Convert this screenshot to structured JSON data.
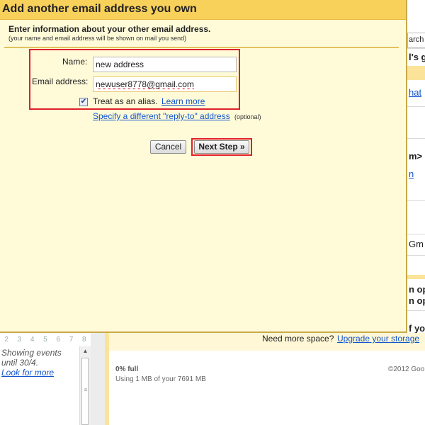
{
  "dialog": {
    "title": "Add another email address you own",
    "heading": "Enter information about your other email address.",
    "subnote": "(your name and email address will be shown on mail you send)",
    "name_label": "Name:",
    "name_value": "new address",
    "email_label": "Email address:",
    "email_value": "newuser8778@gmail.com",
    "alias_checked": true,
    "alias_check_mark": "✔",
    "alias_label": "Treat as an alias.",
    "learn_more": "Learn more",
    "reply_to_link": "Specify a different \"reply-to\" address",
    "optional": "(optional)",
    "cancel": "Cancel",
    "next_step": "Next Step »"
  },
  "background": {
    "right_fragments": [
      "arch",
      "l's g",
      "hat",
      "m>",
      "n",
      "Gm",
      "n op",
      "n op",
      "f yo"
    ],
    "calendar_days": [
      "2",
      "3",
      "4",
      "5",
      "6",
      "7",
      "8"
    ],
    "events_text": "Showing events until 30/4.",
    "look_more": "Look for more",
    "need_space": "Need more space?",
    "upgrade": "Upgrade your storage",
    "storage_pct": "0% full",
    "storage_using": "Using 1 MB of your 7691 MB",
    "copyright": "©2012 Goo"
  },
  "colors": {
    "title_bar": "#f8d15b",
    "dialog_bg": "#fffbd9",
    "highlight": "#e0202a",
    "link": "#1155cc"
  }
}
